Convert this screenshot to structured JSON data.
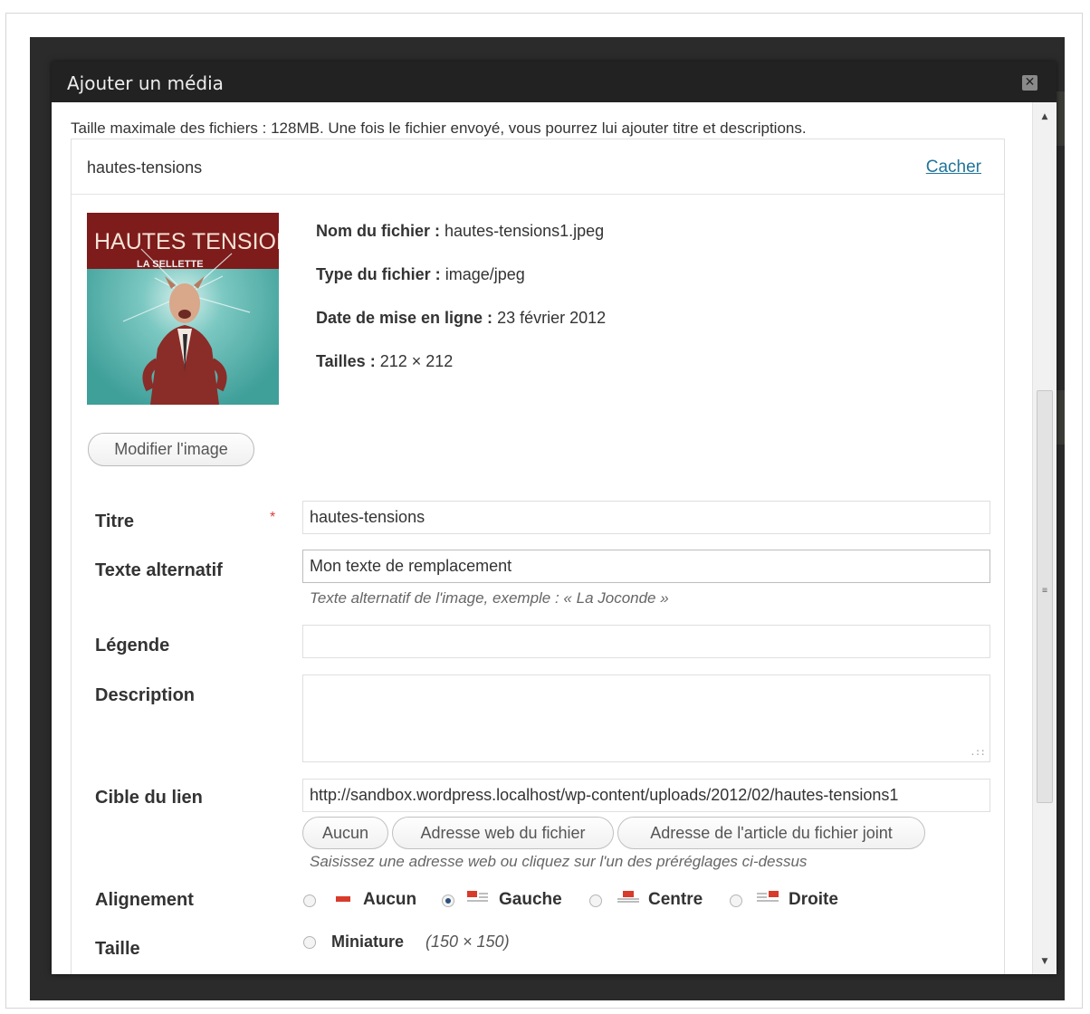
{
  "dialog": {
    "title": "Ajouter un média",
    "close_glyph": "✕"
  },
  "upload": {
    "max_size_text": "Taille maximale des fichiers : 128MB. Une fois le fichier envoyé, vous pourrez lui ajouter titre et descriptions."
  },
  "media": {
    "name": "hautes-tensions",
    "hide_link": "Cacher",
    "thumbnail": {
      "title_text": "HAUTES TENSIONS",
      "subtitle_text": "LA SELLETTE",
      "colors": {
        "top": "#7e1b1b",
        "bottom": "#4fa9a4"
      }
    },
    "edit_image_button": "Modifier l'image",
    "file_name_label": "Nom du fichier :",
    "file_name_value": "hautes-tensions1.jpeg",
    "file_type_label": "Type du fichier :",
    "file_type_value": "image/jpeg",
    "upload_date_label": "Date de mise en ligne :",
    "upload_date_value": "23 février 2012",
    "sizes_label": "Tailles :",
    "sizes_value": "212 × 212"
  },
  "form": {
    "title_label": "Titre",
    "required_mark": "*",
    "title_value": "hautes-tensions",
    "alt_label": "Texte alternatif",
    "alt_value": "Mon texte de remplacement",
    "alt_hint": "Texte alternatif de l'image, exemple : « La Joconde »",
    "caption_label": "Légende",
    "caption_value": "",
    "description_label": "Description",
    "description_value": "",
    "link_label": "Cible du lien",
    "link_value": "http://sandbox.wordpress.localhost/wp-content/uploads/2012/02/hautes-tensions1",
    "link_buttons": [
      "Aucun",
      "Adresse web du fichier",
      "Adresse de l'article du fichier joint"
    ],
    "link_hint": "Saisissez une adresse web ou cliquez sur l'un des préréglages ci-dessus",
    "alignment_label": "Alignement",
    "alignment_options": [
      {
        "label": "Aucun",
        "icon": "align-none-icon",
        "checked": false
      },
      {
        "label": "Gauche",
        "icon": "align-left-icon",
        "checked": true
      },
      {
        "label": "Centre",
        "icon": "align-center-icon",
        "checked": false
      },
      {
        "label": "Droite",
        "icon": "align-right-icon",
        "checked": false
      }
    ],
    "size_label": "Taille",
    "size_options": [
      {
        "label": "Miniature",
        "dims": "(150 × 150)",
        "checked": false
      }
    ]
  },
  "colors": {
    "titlebar": "#222222",
    "link": "#21759b",
    "required": "#e03b3b",
    "align_red": "#d83b2b"
  }
}
